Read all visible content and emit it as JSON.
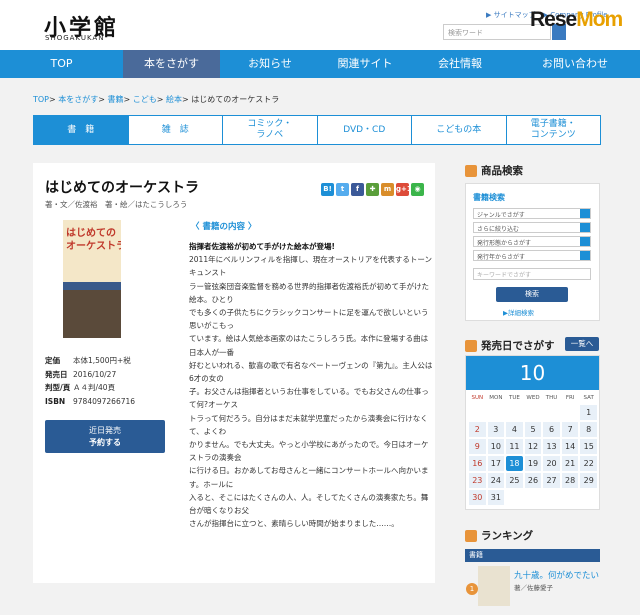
{
  "header": {
    "logo": "小学館",
    "logo_sub": "SHOGAKUKAN",
    "links": "▶ サイトマップ　▶ Company Profile",
    "search_placeholder": "検索ワード",
    "watermark_a": "Rese",
    "watermark_b": "Mom"
  },
  "nav": [
    "TOP",
    "本をさがす",
    "お知らせ",
    "関連サイト",
    "会社情報",
    "お問い合わせ"
  ],
  "breadcrumb": {
    "items": [
      "TOP",
      "本をさがす",
      "書籍",
      "こども",
      "絵本"
    ],
    "current": "はじめてのオーケストラ"
  },
  "tabs": [
    "書　籍",
    "雑　誌",
    "コミック・\nラノベ",
    "DVD・CD",
    "こどもの本",
    "電子書籍・\nコンテンツ"
  ],
  "book": {
    "title": "はじめてのオーケストラ",
    "authors": "著・文／佐渡裕　著・絵／はたこうしろう",
    "cover_title": "はじめての\nオーケストラ",
    "info": [
      {
        "k": "定価",
        "v": "本体1,500円+税"
      },
      {
        "k": "発売日",
        "v": "2016/10/27"
      },
      {
        "k": "判型/頁",
        "v": "Ａ４判/40頁"
      },
      {
        "k": "ISBN",
        "v": "9784097266716"
      }
    ],
    "buy_top": "近日発売",
    "buy_bottom": "予約する",
    "desc_heading": "〈 書籍の内容 〉",
    "desc_bold": "指揮者佐渡裕が初めて手がけた絵本が登場!",
    "desc_body": "2011年にベルリンフィルを指揮し、現在オーストリアを代表するトーンキュンスト\nラー管弦楽団音楽監督を務める世界的指揮者佐渡裕氏が初めて手がけた絵本。ひとり\nでも多くの子供たちにクラシックコンサートに足を運んで欲しいという思いがこもっ\nています。絵は人気絵本画家のはたこうしろう氏。本作に登場する曲は日本人が一番\n好むといわれる、歓喜の歌で有名なベートーヴェンの『第九』。主人公は6才の女の\n子。お父さんは指揮者というお仕事をしている。でもお父さんの仕事って何?オーケス\nトラって何だろう。自分はまだ未就学児童だったから演奏会に行けなくて、よくわ\nかりません。でも大丈夫。やっと小学校にあがったので。今日はオーケストラの演奏会\nに行ける日。おかあしてお母さんと一緒にコンサートホールへ向かいます。ホールに\n入ると、そこにはたくさんの人、人。そしてたくさんの演奏家たち。舞台が暗くなりお父\nさんが指揮台に立つと、素晴らしい時間が始まりました……。"
  },
  "share": [
    {
      "l": "B!",
      "c": "#1d8fd6"
    },
    {
      "l": "t",
      "c": "#55acee"
    },
    {
      "l": "f",
      "c": "#3b5998"
    },
    {
      "l": "✚",
      "c": "#5a9e3a"
    },
    {
      "l": "m",
      "c": "#d98d2a"
    },
    {
      "l": "g+1",
      "c": "#dd4b39"
    },
    {
      "l": "◉",
      "c": "#3bb54a"
    }
  ],
  "side": {
    "search_title": "商品検索",
    "search_sub": "書籍検索",
    "selects": [
      "ジャンルでさがす",
      "さらに絞り込む",
      "発行形態からさがす",
      "発行年からさがす"
    ],
    "kw_placeholder": "キーワードでさがす",
    "go": "検索",
    "adv": "▶詳細検索",
    "cal_title": "発売日でさがす",
    "cal_more": "一覧へ",
    "month": "10",
    "days": [
      "SUN",
      "MON",
      "TUE",
      "WED",
      "THU",
      "FRI",
      "SAT"
    ],
    "dates": [
      "",
      "",
      "",
      "",
      "",
      "",
      "1",
      "2",
      "3",
      "4",
      "5",
      "6",
      "7",
      "8",
      "9",
      "10",
      "11",
      "12",
      "13",
      "14",
      "15",
      "16",
      "17",
      "18",
      "19",
      "20",
      "21",
      "22",
      "23",
      "24",
      "25",
      "26",
      "27",
      "28",
      "29",
      "30",
      "31"
    ],
    "today": "18",
    "rank_title": "ランキング",
    "rank_bar": "書籍",
    "rank_no": "1",
    "rank_book": "九十歳。何がめでたい",
    "rank_author": "著／佐藤愛子"
  }
}
